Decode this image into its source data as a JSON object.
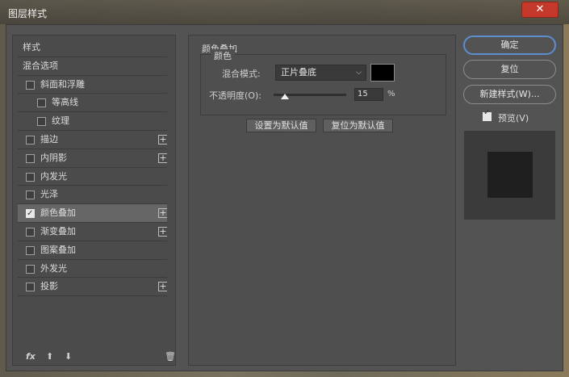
{
  "window": {
    "title": "图层样式",
    "close_label": "✕"
  },
  "styles": {
    "items": [
      {
        "label": "样式",
        "kind": "header"
      },
      {
        "label": "混合选项",
        "kind": "header"
      },
      {
        "label": "斜面和浮雕",
        "kind": "check",
        "checked": false,
        "plus": false
      },
      {
        "label": "等高线",
        "kind": "sub",
        "checked": false,
        "plus": false
      },
      {
        "label": "纹理",
        "kind": "sub",
        "checked": false,
        "plus": false
      },
      {
        "label": "描边",
        "kind": "check",
        "checked": false,
        "plus": true
      },
      {
        "label": "内阴影",
        "kind": "check",
        "checked": false,
        "plus": true
      },
      {
        "label": "内发光",
        "kind": "check",
        "checked": false,
        "plus": false
      },
      {
        "label": "光泽",
        "kind": "check",
        "checked": false,
        "plus": false
      },
      {
        "label": "颜色叠加",
        "kind": "check",
        "checked": true,
        "plus": true,
        "selected": true
      },
      {
        "label": "渐变叠加",
        "kind": "check",
        "checked": false,
        "plus": true
      },
      {
        "label": "图案叠加",
        "kind": "check",
        "checked": false,
        "plus": false
      },
      {
        "label": "外发光",
        "kind": "check",
        "checked": false,
        "plus": false
      },
      {
        "label": "投影",
        "kind": "check",
        "checked": false,
        "plus": true
      }
    ],
    "tools": {
      "fx": "fx",
      "up": "⬆",
      "down": "⬇",
      "trash": "🗑"
    },
    "icons": [
      "fx-icon",
      "arrow-up-icon",
      "arrow-down-icon",
      "trash-icon",
      "plus-icon"
    ]
  },
  "color_overlay": {
    "section_title": "颜色叠加",
    "group_title": "颜色",
    "blend_mode_label": "混合模式:",
    "blend_mode_value": "正片叠底",
    "blend_color": "#000000",
    "opacity_label": "不透明度(O):",
    "opacity_value": "15",
    "opacity_unit": "%",
    "opacity_fraction": 0.15,
    "set_default_label": "设置为默认值",
    "reset_default_label": "复位为默认值"
  },
  "actions": {
    "ok_label": "确定",
    "reset_label": "复位",
    "new_style_label": "新建样式(W)...",
    "preview_label": "预览(V)",
    "preview_checked": true
  }
}
